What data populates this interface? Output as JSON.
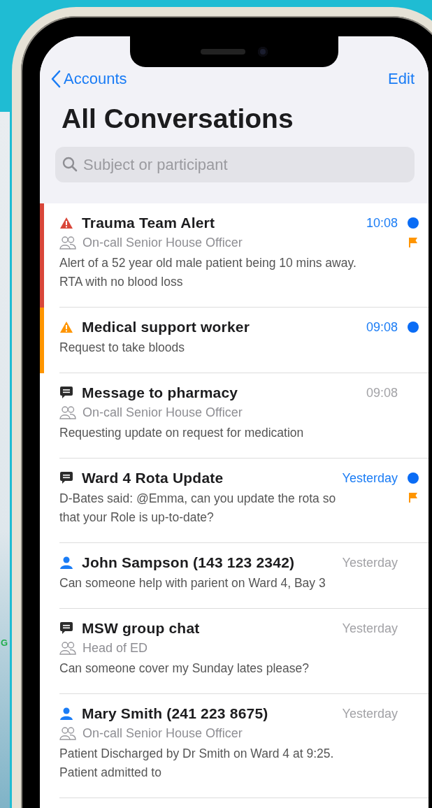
{
  "background_phone": {
    "text": "G"
  },
  "nav": {
    "back": "Accounts",
    "action": "Edit"
  },
  "title": "All Conversations",
  "search": {
    "placeholder": "Subject or participant"
  },
  "conversations": [
    {
      "color": "#d9473a",
      "kind": "alert",
      "title": "Trauma Team Alert",
      "time": "10:08",
      "unread": true,
      "flagged": true,
      "role": "On-call Senior House Officer",
      "preview": "Alert of a 52 year old male patient being 10 mins away. RTA with no blood loss"
    },
    {
      "color": "#ff9500",
      "kind": "alert",
      "title": "Medical support worker",
      "time": "09:08",
      "unread": true,
      "flagged": false,
      "preview": "Request to take bloods"
    },
    {
      "kind": "chat",
      "title": "Message to pharmacy",
      "time": "09:08",
      "unread": false,
      "flagged": false,
      "role": "On-call Senior House Officer",
      "preview": "Requesting update on request for medication"
    },
    {
      "kind": "chat",
      "title": "Ward 4 Rota Update",
      "time": "Yesterday",
      "unread": true,
      "flagged": true,
      "preview": "D-Bates said: @Emma, can you update the rota so that your Role is up-to-date?"
    },
    {
      "kind": "person",
      "title": "John Sampson (143 123 2342)",
      "time": "Yesterday",
      "unread": false,
      "flagged": false,
      "preview": "Can someone help with parient on Ward 4, Bay 3"
    },
    {
      "kind": "chat",
      "title": "MSW group chat",
      "time": "Yesterday",
      "unread": false,
      "flagged": false,
      "role": "Head of ED",
      "preview": "Can someone cover my Sunday lates please?"
    },
    {
      "kind": "person",
      "title": "Mary Smith (241 223 8675)",
      "time": "Yesterday",
      "unread": false,
      "flagged": false,
      "role": "On-call Senior House Officer",
      "preview": "Patient Discharged by Dr Smith on Ward 4 at 9:25. Patient admitted to"
    }
  ]
}
